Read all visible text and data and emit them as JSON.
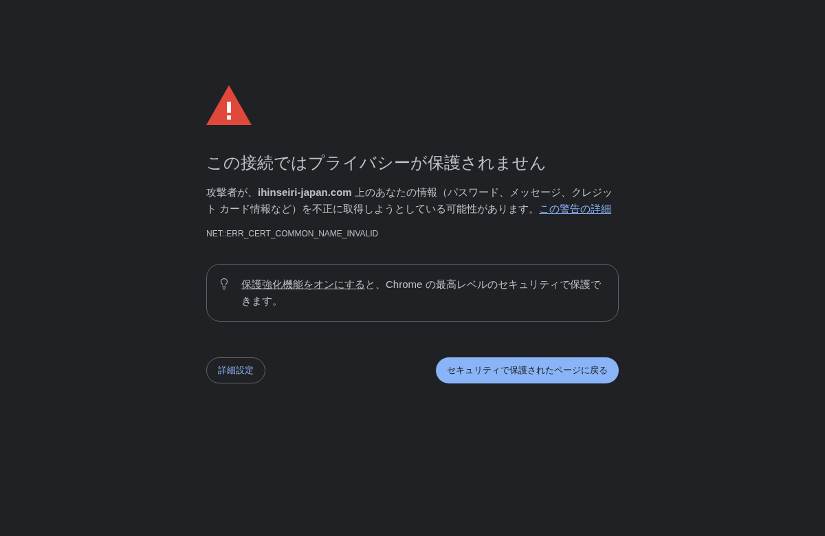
{
  "heading": "この接続ではプライバシーが保護されません",
  "description": {
    "text": "攻撃者が、**ihinseiri-japan.com** 上のあなたの情報（パスワード、メッセージ、クレジット カード情報など）を不正に取得しようとしている可能性があります。",
    "link": "この警告の詳細"
  },
  "error_code": "NET::ERR_CERT_COMMON_NAME_INVALID",
  "tip": {
    "link": "保護強化機能をオンにする",
    "text": "と、Chrome の最高レベルのセキュリティで保護できます。"
  },
  "buttons": [
    {
      "kind": "secondary",
      "label": "詳細設定"
    },
    {
      "kind": "primary",
      "label": "セキュリティで保護されたページに戻る"
    }
  ]
}
